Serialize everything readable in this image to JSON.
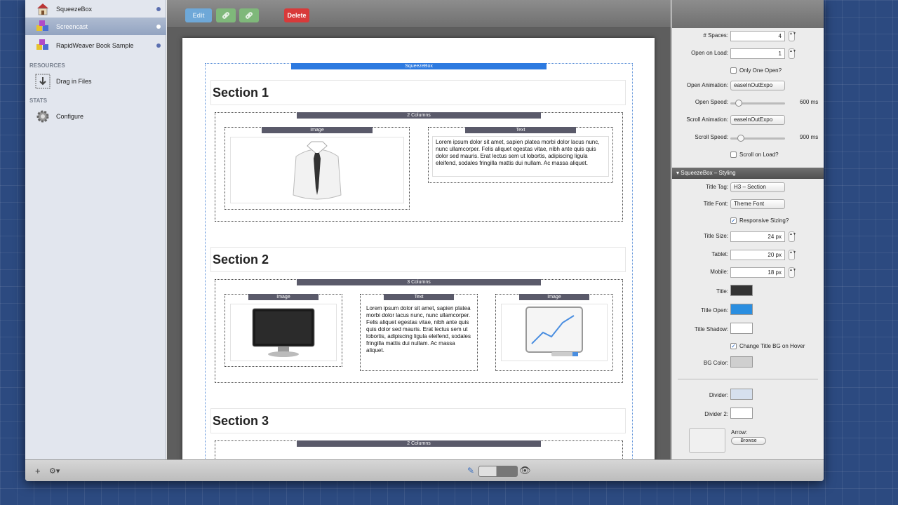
{
  "sidebar": {
    "items": [
      {
        "label": "SqueezeBox",
        "icon": "house-icon"
      },
      {
        "label": "Screencast",
        "icon": "cubes-icon"
      },
      {
        "label": "RapidWeaver Book Sample",
        "icon": "cubes-icon"
      }
    ],
    "resources_heading": "RESOURCES",
    "drag_label": "Drag in Files",
    "stats_heading": "STATS",
    "configure_label": "Configure"
  },
  "toolbar": {
    "edit_label": "Edit",
    "delete_label": "Delete"
  },
  "page": {
    "squeezebox_bar": "SqueezeBox",
    "sections": [
      {
        "title": "Section 1",
        "columns_label": "2 Columns"
      },
      {
        "title": "Section 2",
        "columns_label": "3 Columns"
      },
      {
        "title": "Section 3",
        "columns_label": "2 Columns"
      }
    ],
    "image_label": "Image",
    "text_label": "Text",
    "lorem_1": "Lorem ipsum dolor sit amet, sapien platea morbi dolor lacus nunc, nunc ullamcorper. Felis aliquet egestas vitae, nibh ante quis quis dolor sed mauris. Erat lectus sem ut lobortis, adipiscing ligula eleifend, sodales fringilla mattis dui nullam. Ac massa aliquet.",
    "lorem_2": "Lorem ipsum dolor sit amet, sapien platea morbi dolor lacus nunc, nunc ullamcorper. Felis aliquet egestas vitae, nibh ante quis quis dolor sed mauris. Erat lectus sem ut lobortis, adipiscing ligula eleifend, sodales fringilla mattis dui nullam. Ac massa aliquet."
  },
  "inspector": {
    "spaces_label": "# Spaces:",
    "spaces_value": "4",
    "open_on_load_label": "Open on Load:",
    "open_on_load_value": "1",
    "only_one_open_label": "Only One Open?",
    "open_animation_label": "Open Animation:",
    "open_animation_value": "easeInOutExpo",
    "open_speed_label": "Open Speed:",
    "open_speed_value": "600 ms",
    "open_speed_level": 0.1,
    "scroll_animation_label": "Scroll Animation:",
    "scroll_animation_value": "easeInOutExpo",
    "scroll_speed_label": "Scroll Speed:",
    "scroll_speed_value": "900 ms",
    "scroll_speed_level": 0.15,
    "scroll_on_load_label": "Scroll on Load?",
    "styling_header": "SqueezeBox – Styling",
    "title_tag_label": "Title Tag:",
    "title_tag_value": "H3 – Section",
    "title_font_label": "Title Font:",
    "title_font_value": "Theme Font",
    "responsive_label": "Responsive Sizing?",
    "title_size_label": "Title Size:",
    "title_size_value": "24 px",
    "tablet_label": "Tablet:",
    "tablet_value": "20 px",
    "mobile_label": "Mobile:",
    "mobile_value": "18 px",
    "title_color_label": "Title:",
    "title_open_label": "Title Open:",
    "title_shadow_label": "Title Shadow:",
    "change_bg_label": "Change Title BG on Hover",
    "bg_color_label": "BG Color:",
    "divider_label": "Divider:",
    "divider2_label": "Divider 2:",
    "arrow_label": "Arrow:",
    "browse_label": "Browse"
  },
  "colors": {
    "title": "#333333",
    "title_open": "#2a8ee0",
    "title_shadow": "#ffffff",
    "bg_color": "#cfcfcf",
    "divider": "#d6e0ee",
    "divider2": "#ffffff"
  }
}
